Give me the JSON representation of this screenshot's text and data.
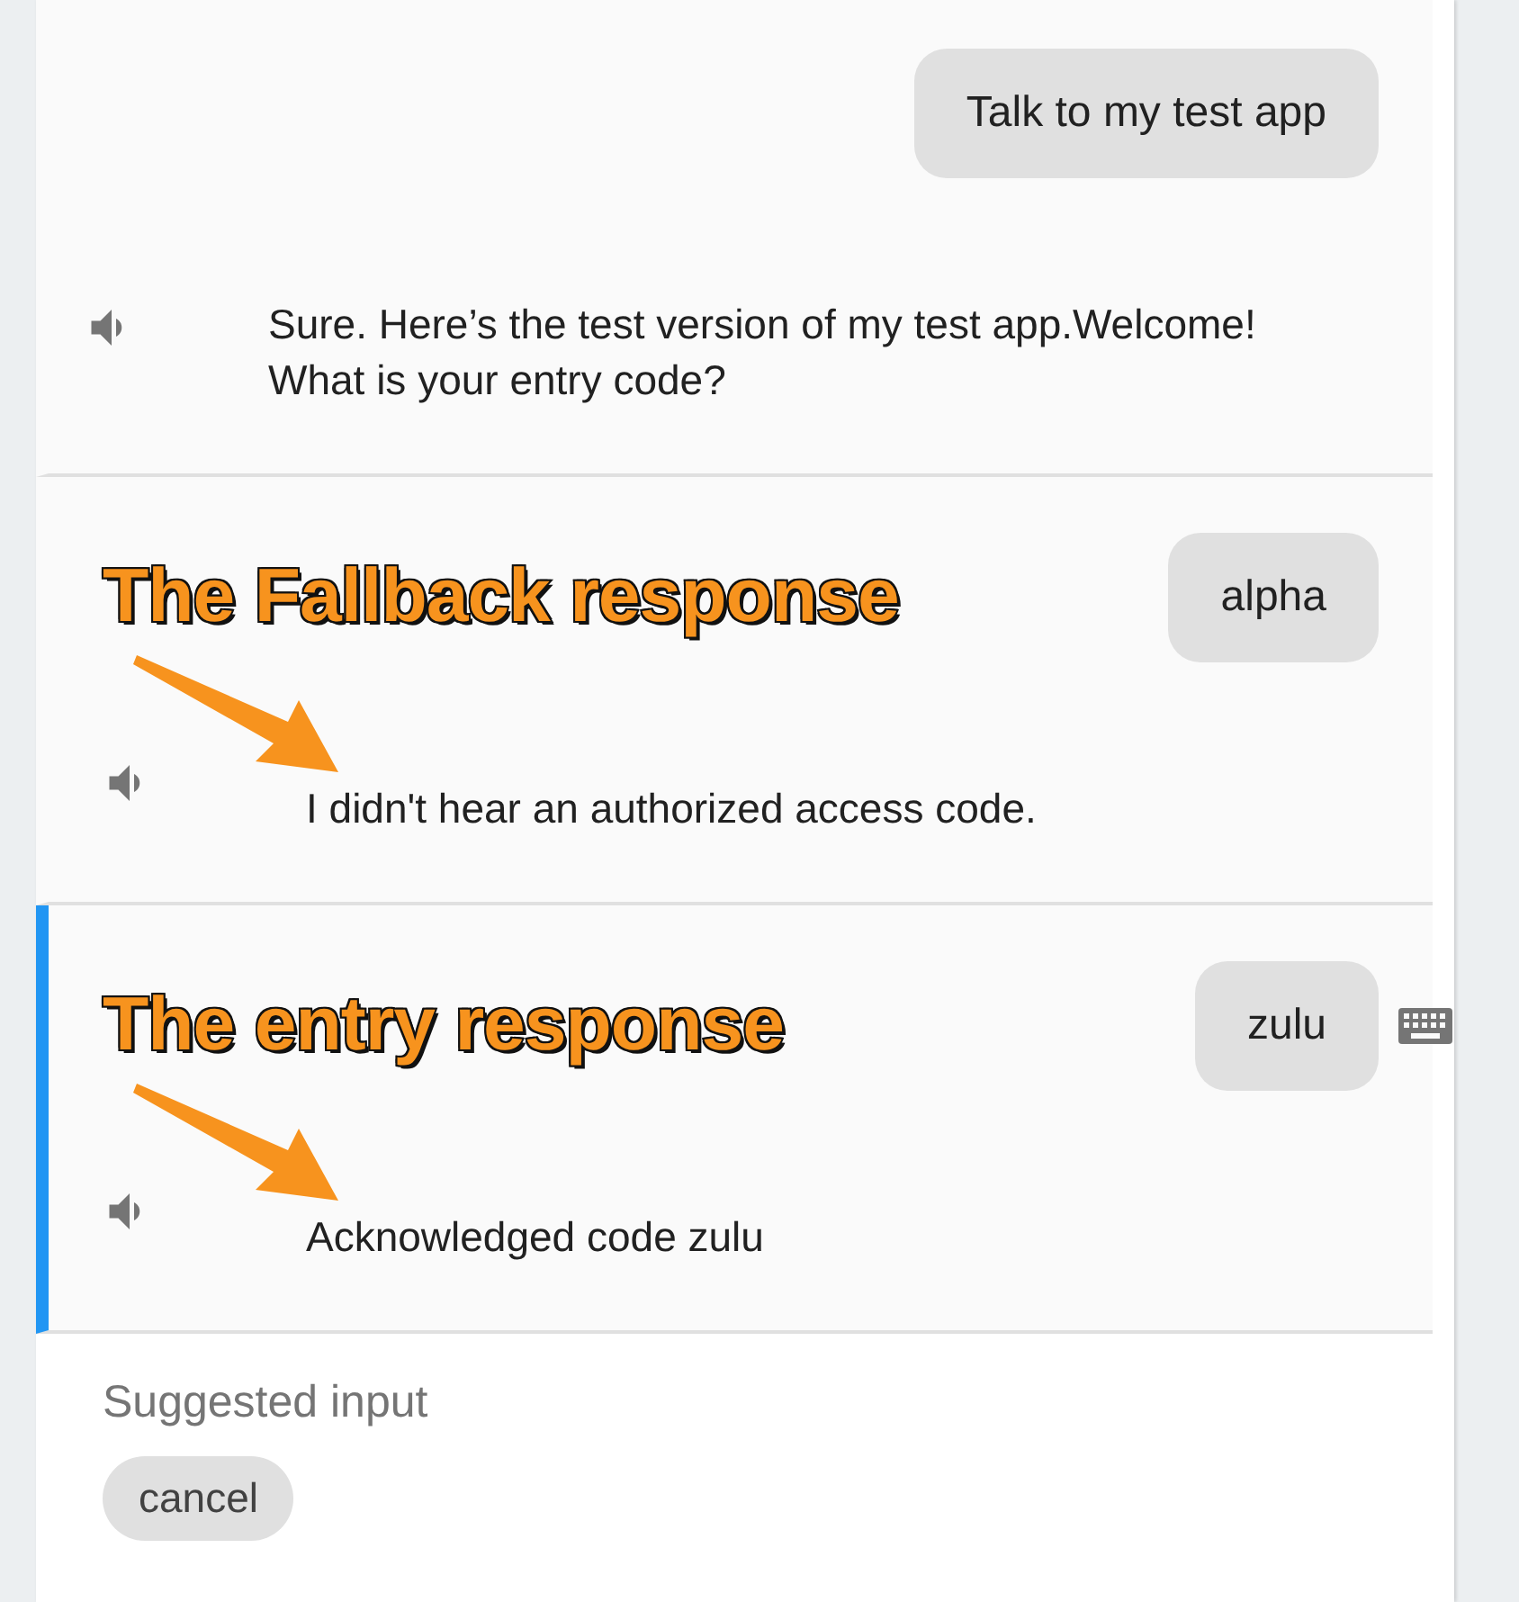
{
  "turns": [
    {
      "user_text": "Talk to my test app",
      "response": "Sure. Here’s the test version of my test app.Welcome! What is your entry code?",
      "selected": false,
      "keyboard_icon": false
    },
    {
      "user_text": "alpha",
      "response": "I didn't hear an authorized access code.",
      "selected": false,
      "keyboard_icon": false,
      "annotation": "The Fallback response"
    },
    {
      "user_text": "zulu",
      "response": "Acknowledged code zulu",
      "selected": true,
      "keyboard_icon": true,
      "annotation": "The entry response"
    }
  ],
  "suggested_input": {
    "label": "Suggested input",
    "chips": [
      "cancel"
    ]
  }
}
